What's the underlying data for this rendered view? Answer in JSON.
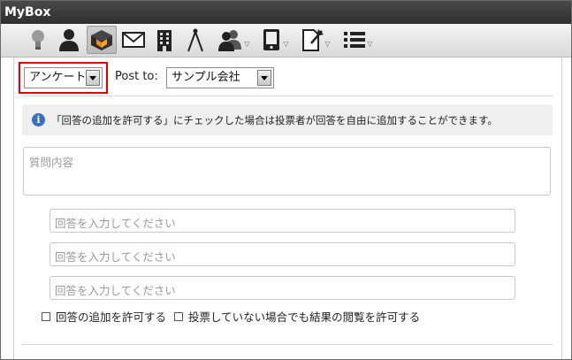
{
  "app": {
    "title": "MyBox"
  },
  "toolbar": {
    "items": [
      {
        "icon": "lightbulb-icon"
      },
      {
        "icon": "person-icon"
      },
      {
        "icon": "box-icon",
        "active": true
      },
      {
        "icon": "mail-icon"
      },
      {
        "icon": "building-icon"
      },
      {
        "icon": "compass-icon"
      },
      {
        "icon": "users-icon",
        "dropdown": true
      },
      {
        "icon": "device-icon",
        "dropdown": true
      },
      {
        "icon": "document-pin-icon",
        "dropdown": true
      },
      {
        "icon": "list-icon",
        "dropdown": true
      }
    ]
  },
  "form": {
    "type_select": {
      "value": "アンケート"
    },
    "post_to_label": "Post to:",
    "post_to_select": {
      "value": "サンプル会社"
    },
    "info_text": "「回答の追加を許可する」にチェックした場合は投票者が回答を自由に追加することができます。",
    "question": {
      "placeholder": "質問内容"
    },
    "answers": [
      {
        "placeholder": "回答を入力してください"
      },
      {
        "placeholder": "回答を入力してください"
      },
      {
        "placeholder": "回答を入力してください"
      }
    ],
    "options": [
      {
        "label": "回答の追加を許可する",
        "checked": false
      },
      {
        "label": "投票していない場合でも結果の閲覧を許可する",
        "checked": false
      }
    ]
  },
  "colors": {
    "highlight": "#e00000",
    "titlebar": "#3a3a3a",
    "info_icon": "#3a6fc4"
  }
}
